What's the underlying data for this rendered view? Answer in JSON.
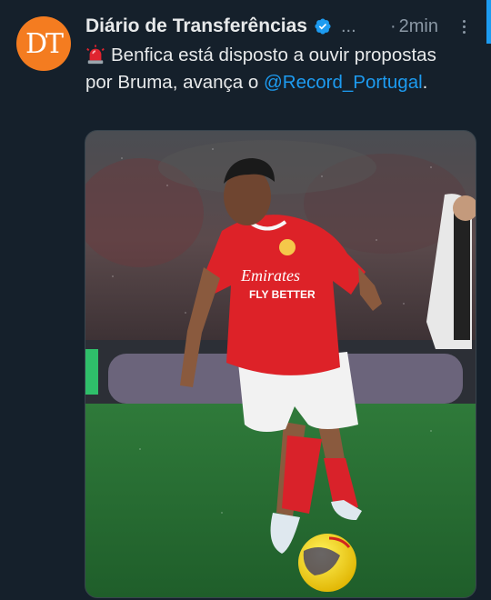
{
  "tweet": {
    "avatar_text": "DT",
    "display_name": "Diário de Transferências",
    "handle_ellipsis": "...",
    "separator": "·",
    "time": "2min",
    "text_before_mention": "Benfica está disposto a ouvir propostas por Bruma, avança o",
    "mention": "@Record_Portugal",
    "text_after_mention": "."
  },
  "media": {
    "description_icon": "football-photo",
    "jersey_sponsor_line1": "Emirates",
    "jersey_sponsor_line2": "FLY BETTER"
  },
  "colors": {
    "background": "#15202b",
    "accent": "#1d9bf0",
    "avatar": "#f47c20",
    "secondary_text": "#8b98a5"
  }
}
